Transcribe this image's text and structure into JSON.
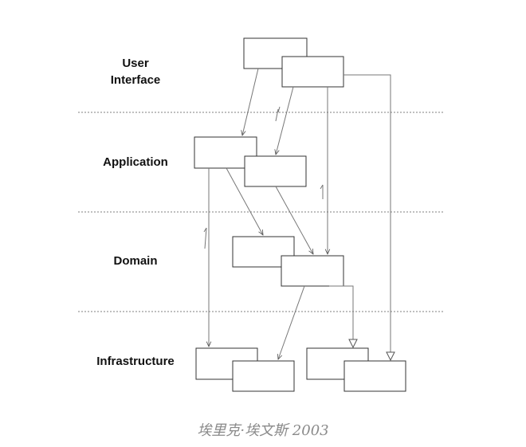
{
  "layers": {
    "user_interface": [
      "User",
      "Interface"
    ],
    "application": "Application",
    "domain": "Domain",
    "infrastructure": "Infrastructure"
  },
  "caption": "埃里克·埃文斯 2003",
  "colors": {
    "line": "#777777",
    "box_stroke": "#333333",
    "separator": "#aaaaaa",
    "caption": "#8a8a8a"
  }
}
